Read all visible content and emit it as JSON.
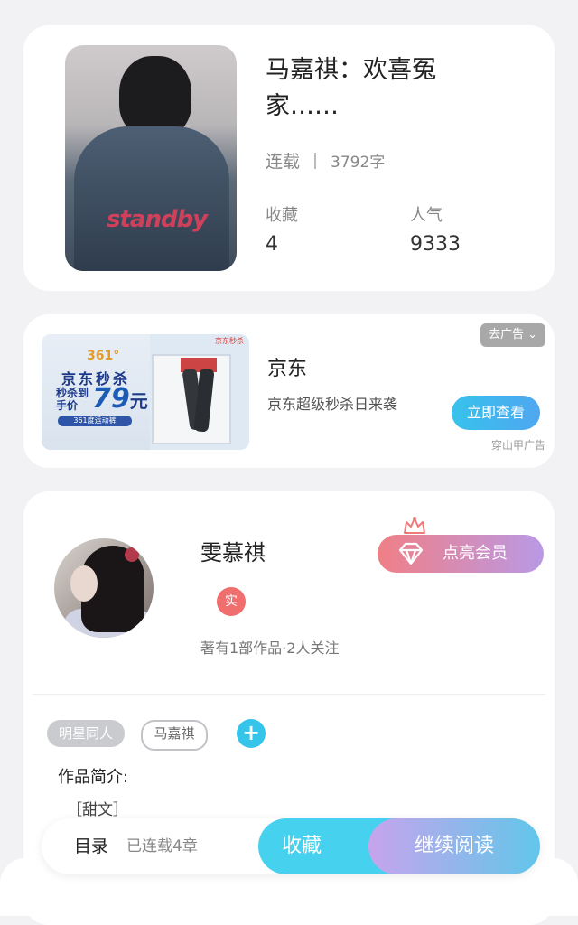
{
  "book": {
    "title": "马嘉祺：欢喜冤家……",
    "status": "连载",
    "word_count": "3792字",
    "favorites_label": "收藏",
    "favorites_value": "4",
    "popularity_label": "人气",
    "popularity_value": "9333",
    "cover_logo": "standby"
  },
  "ad": {
    "close_label": "去广告 ⌄",
    "advertiser": "京东",
    "description": "京东超级秒杀日来袭",
    "cta": "立即查看",
    "source": "穿山甲广告",
    "image": {
      "brand": "361°",
      "headline": "京东秒杀",
      "price_prefix": "秒杀到手价",
      "price": "79",
      "currency": "元",
      "badge": "361度运动裤",
      "tag": "京东秒杀"
    }
  },
  "author": {
    "name": "雯慕祺",
    "verified_label": "实",
    "meta": "著有1部作品·2人关注",
    "vip_button": "点亮会员"
  },
  "tags": [
    "明星同人",
    "马嘉祺"
  ],
  "intro": {
    "label": "作品简介:",
    "text": "［甜文］"
  },
  "bottom_bar": {
    "toc": "目录",
    "chapters": "已连载4章",
    "favorite": "收藏",
    "continue": "继续阅读"
  },
  "colors": {
    "accent_blue": "#46d1ee",
    "vip_pink": "#f07f86",
    "vip_purple": "#b999e6",
    "verified_red": "#f06e6e"
  }
}
